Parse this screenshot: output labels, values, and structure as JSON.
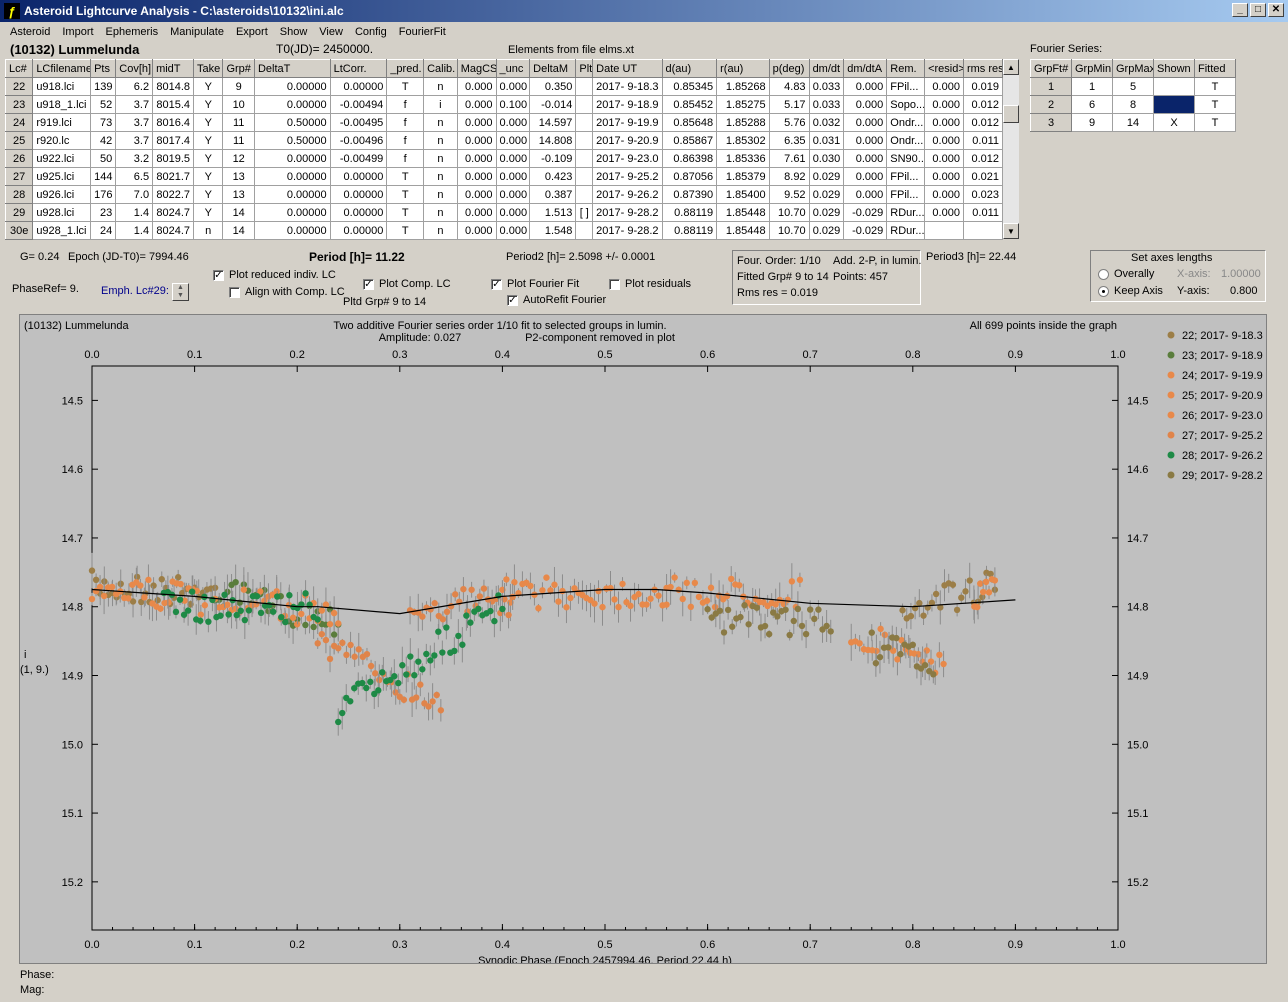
{
  "window": {
    "title": "Asteroid Lightcurve Analysis - C:\\asteroids\\10132\\ini.alc",
    "app_icon": "ALC"
  },
  "menu": [
    "Asteroid",
    "Import",
    "Ephemeris",
    "Manipulate",
    "Export",
    "Show",
    "View",
    "Config",
    "FourierFit"
  ],
  "header": {
    "asteroid": "(10132) Lummelunda",
    "t0": "T0(JD)= 2450000.",
    "elements": "Elements from file elms.xt",
    "fourier_label": "Fourier Series:"
  },
  "lc_table": {
    "columns": [
      "Lc#",
      "LCfilename",
      "Pts",
      "Cov[h]",
      "midT",
      "Take",
      "Grp#",
      "DeltaT",
      "LtCorr.",
      "_pred.",
      "Calib.",
      "MagCS",
      "_unc",
      "DeltaM",
      "Plt",
      "Date UT",
      "d(au)",
      "r(au)",
      "p(deg)",
      "dm/dt",
      "dm/dtA",
      "Rem.",
      "<resid>",
      "rms res"
    ],
    "rows": [
      [
        "22",
        "u918.lci",
        "139",
        "6.2",
        "8014.8",
        "Y",
        "9",
        "0.00000",
        "0.00000",
        "T",
        "n",
        "0.000",
        "0.000",
        "0.350",
        "",
        "2017- 9-18.3",
        "0.85345",
        "1.85268",
        "4.83",
        "0.033",
        "0.000",
        "FPil...",
        "0.000",
        "0.019"
      ],
      [
        "23",
        "u918_1.lci",
        "52",
        "3.7",
        "8015.4",
        "Y",
        "10",
        "0.00000",
        "-0.00494",
        "f",
        "i",
        "0.000",
        "0.100",
        "-0.014",
        "",
        "2017- 9-18.9",
        "0.85452",
        "1.85275",
        "5.17",
        "0.033",
        "0.000",
        "Sopo...",
        "0.000",
        "0.012"
      ],
      [
        "24",
        "r919.lci",
        "73",
        "3.7",
        "8016.4",
        "Y",
        "11",
        "0.50000",
        "-0.00495",
        "f",
        "n",
        "0.000",
        "0.000",
        "14.597",
        "",
        "2017- 9-19.9",
        "0.85648",
        "1.85288",
        "5.76",
        "0.032",
        "0.000",
        "Ondr...",
        "0.000",
        "0.012"
      ],
      [
        "25",
        "r920.lc",
        "42",
        "3.7",
        "8017.4",
        "Y",
        "11",
        "0.50000",
        "-0.00496",
        "f",
        "n",
        "0.000",
        "0.000",
        "14.808",
        "",
        "2017- 9-20.9",
        "0.85867",
        "1.85302",
        "6.35",
        "0.031",
        "0.000",
        "Ondr...",
        "0.000",
        "0.011"
      ],
      [
        "26",
        "u922.lci",
        "50",
        "3.2",
        "8019.5",
        "Y",
        "12",
        "0.00000",
        "-0.00499",
        "f",
        "n",
        "0.000",
        "0.000",
        "-0.109",
        "",
        "2017- 9-23.0",
        "0.86398",
        "1.85336",
        "7.61",
        "0.030",
        "0.000",
        "SN90...",
        "0.000",
        "0.012"
      ],
      [
        "27",
        "u925.lci",
        "144",
        "6.5",
        "8021.7",
        "Y",
        "13",
        "0.00000",
        "0.00000",
        "T",
        "n",
        "0.000",
        "0.000",
        "0.423",
        "",
        "2017- 9-25.2",
        "0.87056",
        "1.85379",
        "8.92",
        "0.029",
        "0.000",
        "FPil...",
        "0.000",
        "0.021"
      ],
      [
        "28",
        "u926.lci",
        "176",
        "7.0",
        "8022.7",
        "Y",
        "13",
        "0.00000",
        "0.00000",
        "T",
        "n",
        "0.000",
        "0.000",
        "0.387",
        "",
        "2017- 9-26.2",
        "0.87390",
        "1.85400",
        "9.52",
        "0.029",
        "0.000",
        "FPil...",
        "0.000",
        "0.023"
      ],
      [
        "29",
        "u928.lci",
        "23",
        "1.4",
        "8024.7",
        "Y",
        "14",
        "0.00000",
        "0.00000",
        "T",
        "n",
        "0.000",
        "0.000",
        "1.513",
        "[ ]",
        "2017- 9-28.2",
        "0.88119",
        "1.85448",
        "10.70",
        "0.029",
        "-0.029",
        "RDur...",
        "0.000",
        "0.011"
      ],
      [
        "30e",
        "u928_1.lci",
        "24",
        "1.4",
        "8024.7",
        "n",
        "14",
        "0.00000",
        "0.00000",
        "T",
        "n",
        "0.000",
        "0.000",
        "1.548",
        "",
        "2017- 9-28.2",
        "0.88119",
        "1.85448",
        "10.70",
        "0.029",
        "-0.029",
        "RDur...",
        "",
        ""
      ]
    ]
  },
  "fourier_table": {
    "columns": [
      "GrpFt#",
      "GrpMin",
      "GrpMax",
      "Shown",
      "Fitted"
    ],
    "rows": [
      [
        "1",
        "1",
        "5",
        "",
        "T"
      ],
      [
        "2",
        "6",
        "8",
        "",
        "T"
      ],
      [
        "3",
        "9",
        "14",
        "X",
        "T"
      ]
    ]
  },
  "controls": {
    "g": "G= 0.24",
    "epoch": "Epoch (JD-T0)= 7994.46",
    "period": "Period [h]= 11.22",
    "period2": "Period2 [h]= 2.5098 +/- 0.0001",
    "period3": "Period3 [h]= 22.44",
    "phaseref": "PhaseRef= 9.",
    "emph": "Emph. Lc#29:",
    "plot_reduced": "Plot reduced indiv. LC",
    "align_comp": "Align with Comp. LC",
    "plot_comp": "Plot Comp. LC",
    "plot_fourier": "Plot Fourier Fit",
    "autorefit": "AutoRefit Fourier",
    "plot_resid": "Plot residuals",
    "pltd_grp": "Pltd Grp#  9   to   14",
    "four_order": "Four. Order:  1/10",
    "add2p": "Add. 2-P, in lumin.",
    "fitted_grp": "Fitted Grp# 9 to 14",
    "points": "Points: 457",
    "rms": "Rms res     = 0.019",
    "axes_title": "Set axes lengths",
    "overally": "Overally",
    "keep_axis": "Keep Axis",
    "xaxis_label": "X-axis:",
    "xaxis_val": "1.00000",
    "yaxis_label": "Y-axis:",
    "yaxis_val": "0.800"
  },
  "chart_data": {
    "type": "scatter",
    "title": "Two additive Fourier series order 1/10 fit to selected groups in lumin.",
    "subtitle1": "Amplitude: 0.027",
    "subtitle2": "P2-component removed in plot",
    "corner_left": "(10132) Lummelunda",
    "corner_right": "All 699 points inside the graph",
    "xlabel": "Synodic Phase (Epoch 2457994.46, Period 22.44 h)",
    "ylabel": "i",
    "ylabel2": "(1, 9.)",
    "xlim": [
      0.0,
      1.0
    ],
    "ylim": [
      15.27,
      14.45
    ],
    "yinverted": true,
    "xticks": [
      "0.0",
      "0.1",
      "0.2",
      "0.3",
      "0.4",
      "0.5",
      "0.6",
      "0.7",
      "0.8",
      "0.9",
      "1.0"
    ],
    "yticks": [
      "14.5",
      "14.6",
      "14.7",
      "14.8",
      "14.9",
      "15.0",
      "15.1",
      "15.2"
    ],
    "series": [
      {
        "name": "22; 2017- 9-18.3",
        "color": "#9c7e47",
        "segments": [
          {
            "x": [
              0.0,
              0.12
            ],
            "y": [
              14.77,
              14.78
            ]
          },
          {
            "x": [
              0.79,
              0.88
            ],
            "y": [
              14.8,
              14.77
            ]
          }
        ]
      },
      {
        "name": "23; 2017- 9-18.9",
        "color": "#5a7d3c",
        "segments": [
          {
            "x": [
              0.12,
              0.24
            ],
            "y": [
              14.78,
              14.82
            ]
          }
        ]
      },
      {
        "name": "24; 2017- 9-19.9",
        "color": "#e8894a",
        "segments": [
          {
            "x": [
              0.0,
              0.11
            ],
            "y": [
              14.77,
              14.79
            ]
          },
          {
            "x": [
              0.4,
              0.56
            ],
            "y": [
              14.78,
              14.78
            ]
          }
        ]
      },
      {
        "name": "25; 2017- 9-20.9",
        "color": "#e8894a",
        "segments": [
          {
            "x": [
              0.56,
              0.69
            ],
            "y": [
              14.78,
              14.78
            ]
          },
          {
            "x": [
              0.86,
              0.88
            ],
            "y": [
              14.78,
              14.78
            ]
          }
        ]
      },
      {
        "name": "26; 2017- 9-23.0",
        "color": "#e8894a",
        "segments": [
          {
            "x": [
              0.12,
              0.24
            ],
            "y": [
              14.79,
              14.81
            ]
          },
          {
            "x": [
              0.74,
              0.83
            ],
            "y": [
              14.84,
              14.88
            ]
          }
        ]
      },
      {
        "name": "27; 2017- 9-25.2",
        "color": "#e0844a",
        "segments": [
          {
            "x": [
              0.22,
              0.34
            ],
            "y": [
              14.85,
              14.94
            ]
          },
          {
            "x": [
              0.31,
              0.41
            ],
            "y": [
              14.8,
              14.79
            ]
          }
        ]
      },
      {
        "name": "28; 2017- 9-26.2",
        "color": "#1e8a46",
        "segments": [
          {
            "x": [
              0.07,
              0.22
            ],
            "y": [
              14.8,
              14.8
            ]
          },
          {
            "x": [
              0.24,
              0.4
            ],
            "y": [
              14.95,
              14.8
            ]
          }
        ]
      },
      {
        "name": "29; 2017- 9-28.2",
        "color": "#8a7a44",
        "segments": [
          {
            "x": [
              0.6,
              0.72
            ],
            "y": [
              14.82,
              14.82
            ]
          },
          {
            "x": [
              0.76,
              0.82
            ],
            "y": [
              14.86,
              14.88
            ]
          }
        ]
      }
    ],
    "fit_curve": {
      "x": [
        0.0,
        0.1,
        0.2,
        0.22,
        0.3,
        0.4,
        0.5,
        0.55,
        0.6,
        0.7,
        0.8,
        0.9
      ],
      "y": [
        14.775,
        14.785,
        14.8,
        14.8,
        14.81,
        14.785,
        14.775,
        14.775,
        14.78,
        14.795,
        14.8,
        14.79
      ]
    }
  },
  "status": {
    "phase": "Phase:",
    "mag": "Mag:"
  }
}
